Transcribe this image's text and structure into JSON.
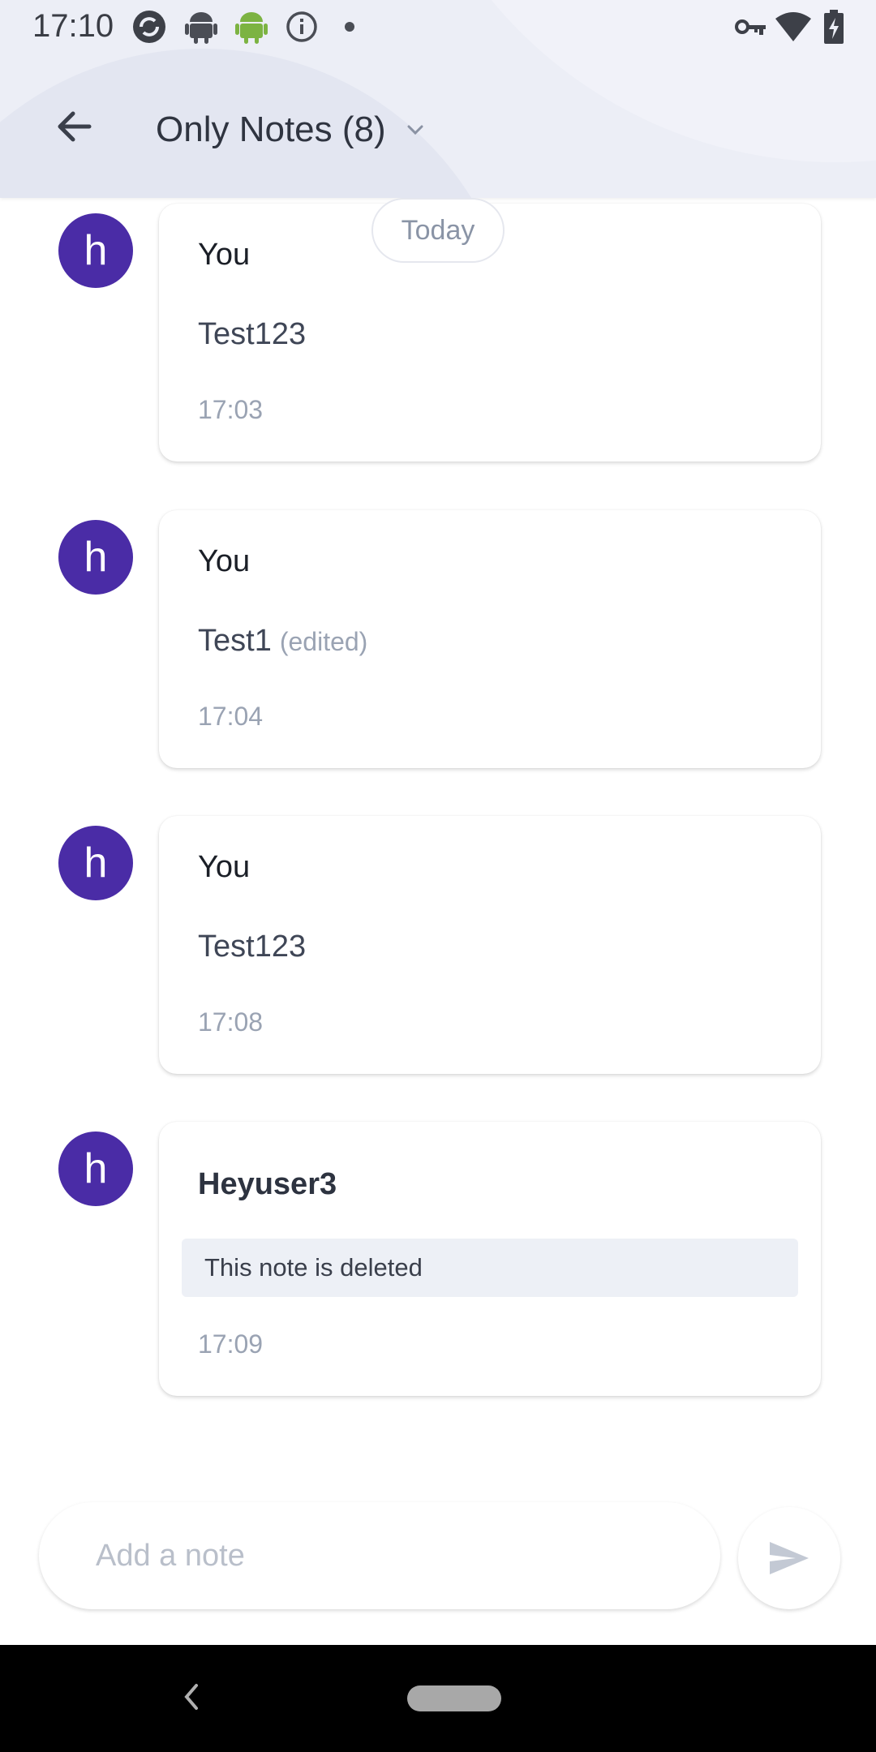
{
  "status_bar": {
    "time": "17:10",
    "left_icons": [
      "sync-icon",
      "android-icon",
      "android-green-icon",
      "info-icon",
      "dot-icon"
    ],
    "right_icons": [
      "vpn-key-icon",
      "wifi-icon",
      "battery-charging-icon"
    ]
  },
  "header": {
    "title": "Only Notes (8)",
    "back_icon": "arrow-left-icon",
    "dropdown_icon": "chevron-down-icon"
  },
  "date_separator": "Today",
  "notes": [
    {
      "avatar": "h",
      "author": "You",
      "text": "Test123",
      "edited": "",
      "time": "17:03",
      "deleted": false
    },
    {
      "avatar": "h",
      "author": "You",
      "text": "Test1",
      "edited": "(edited)",
      "time": "17:04",
      "deleted": false
    },
    {
      "avatar": "h",
      "author": "You",
      "text": "Test123",
      "edited": "",
      "time": "17:08",
      "deleted": false
    },
    {
      "avatar": "h",
      "author": "Heyuser3",
      "text": "This note is deleted",
      "edited": "",
      "time": "17:09",
      "deleted": true
    }
  ],
  "composer": {
    "placeholder": "Add a note",
    "send_icon": "send-icon"
  },
  "colors": {
    "avatar": "#4a2ca6",
    "header_bg": "#eceef6",
    "deleted_bg": "#edf0f6"
  }
}
